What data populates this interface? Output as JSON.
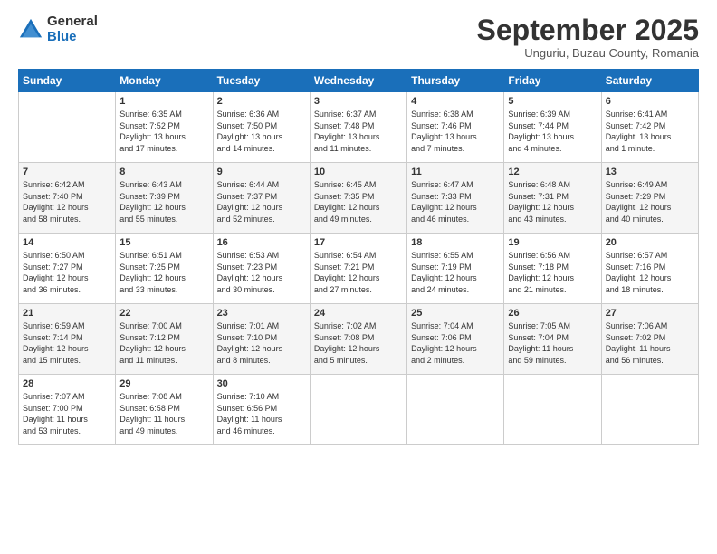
{
  "logo": {
    "general": "General",
    "blue": "Blue"
  },
  "title": "September 2025",
  "subtitle": "Unguriu, Buzau County, Romania",
  "headers": [
    "Sunday",
    "Monday",
    "Tuesday",
    "Wednesday",
    "Thursday",
    "Friday",
    "Saturday"
  ],
  "weeks": [
    [
      {
        "day": "",
        "content": ""
      },
      {
        "day": "1",
        "content": "Sunrise: 6:35 AM\nSunset: 7:52 PM\nDaylight: 13 hours\nand 17 minutes."
      },
      {
        "day": "2",
        "content": "Sunrise: 6:36 AM\nSunset: 7:50 PM\nDaylight: 13 hours\nand 14 minutes."
      },
      {
        "day": "3",
        "content": "Sunrise: 6:37 AM\nSunset: 7:48 PM\nDaylight: 13 hours\nand 11 minutes."
      },
      {
        "day": "4",
        "content": "Sunrise: 6:38 AM\nSunset: 7:46 PM\nDaylight: 13 hours\nand 7 minutes."
      },
      {
        "day": "5",
        "content": "Sunrise: 6:39 AM\nSunset: 7:44 PM\nDaylight: 13 hours\nand 4 minutes."
      },
      {
        "day": "6",
        "content": "Sunrise: 6:41 AM\nSunset: 7:42 PM\nDaylight: 13 hours\nand 1 minute."
      }
    ],
    [
      {
        "day": "7",
        "content": "Sunrise: 6:42 AM\nSunset: 7:40 PM\nDaylight: 12 hours\nand 58 minutes."
      },
      {
        "day": "8",
        "content": "Sunrise: 6:43 AM\nSunset: 7:39 PM\nDaylight: 12 hours\nand 55 minutes."
      },
      {
        "day": "9",
        "content": "Sunrise: 6:44 AM\nSunset: 7:37 PM\nDaylight: 12 hours\nand 52 minutes."
      },
      {
        "day": "10",
        "content": "Sunrise: 6:45 AM\nSunset: 7:35 PM\nDaylight: 12 hours\nand 49 minutes."
      },
      {
        "day": "11",
        "content": "Sunrise: 6:47 AM\nSunset: 7:33 PM\nDaylight: 12 hours\nand 46 minutes."
      },
      {
        "day": "12",
        "content": "Sunrise: 6:48 AM\nSunset: 7:31 PM\nDaylight: 12 hours\nand 43 minutes."
      },
      {
        "day": "13",
        "content": "Sunrise: 6:49 AM\nSunset: 7:29 PM\nDaylight: 12 hours\nand 40 minutes."
      }
    ],
    [
      {
        "day": "14",
        "content": "Sunrise: 6:50 AM\nSunset: 7:27 PM\nDaylight: 12 hours\nand 36 minutes."
      },
      {
        "day": "15",
        "content": "Sunrise: 6:51 AM\nSunset: 7:25 PM\nDaylight: 12 hours\nand 33 minutes."
      },
      {
        "day": "16",
        "content": "Sunrise: 6:53 AM\nSunset: 7:23 PM\nDaylight: 12 hours\nand 30 minutes."
      },
      {
        "day": "17",
        "content": "Sunrise: 6:54 AM\nSunset: 7:21 PM\nDaylight: 12 hours\nand 27 minutes."
      },
      {
        "day": "18",
        "content": "Sunrise: 6:55 AM\nSunset: 7:19 PM\nDaylight: 12 hours\nand 24 minutes."
      },
      {
        "day": "19",
        "content": "Sunrise: 6:56 AM\nSunset: 7:18 PM\nDaylight: 12 hours\nand 21 minutes."
      },
      {
        "day": "20",
        "content": "Sunrise: 6:57 AM\nSunset: 7:16 PM\nDaylight: 12 hours\nand 18 minutes."
      }
    ],
    [
      {
        "day": "21",
        "content": "Sunrise: 6:59 AM\nSunset: 7:14 PM\nDaylight: 12 hours\nand 15 minutes."
      },
      {
        "day": "22",
        "content": "Sunrise: 7:00 AM\nSunset: 7:12 PM\nDaylight: 12 hours\nand 11 minutes."
      },
      {
        "day": "23",
        "content": "Sunrise: 7:01 AM\nSunset: 7:10 PM\nDaylight: 12 hours\nand 8 minutes."
      },
      {
        "day": "24",
        "content": "Sunrise: 7:02 AM\nSunset: 7:08 PM\nDaylight: 12 hours\nand 5 minutes."
      },
      {
        "day": "25",
        "content": "Sunrise: 7:04 AM\nSunset: 7:06 PM\nDaylight: 12 hours\nand 2 minutes."
      },
      {
        "day": "26",
        "content": "Sunrise: 7:05 AM\nSunset: 7:04 PM\nDaylight: 11 hours\nand 59 minutes."
      },
      {
        "day": "27",
        "content": "Sunrise: 7:06 AM\nSunset: 7:02 PM\nDaylight: 11 hours\nand 56 minutes."
      }
    ],
    [
      {
        "day": "28",
        "content": "Sunrise: 7:07 AM\nSunset: 7:00 PM\nDaylight: 11 hours\nand 53 minutes."
      },
      {
        "day": "29",
        "content": "Sunrise: 7:08 AM\nSunset: 6:58 PM\nDaylight: 11 hours\nand 49 minutes."
      },
      {
        "day": "30",
        "content": "Sunrise: 7:10 AM\nSunset: 6:56 PM\nDaylight: 11 hours\nand 46 minutes."
      },
      {
        "day": "",
        "content": ""
      },
      {
        "day": "",
        "content": ""
      },
      {
        "day": "",
        "content": ""
      },
      {
        "day": "",
        "content": ""
      }
    ]
  ]
}
